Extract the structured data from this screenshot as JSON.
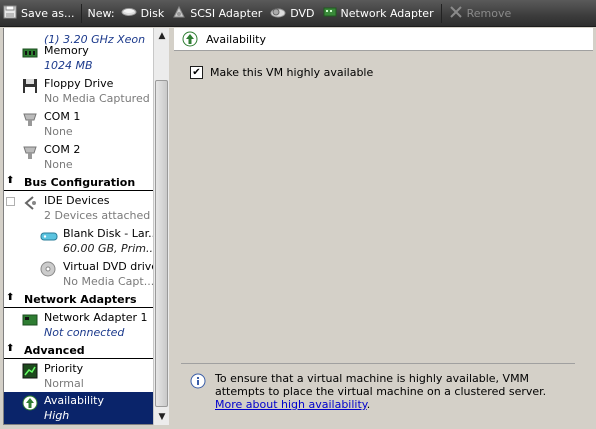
{
  "toolbar": {
    "save_as": "Save as...",
    "new_label": "New:",
    "disk": "Disk",
    "scsi": "SCSI Adapter",
    "dvd": "DVD",
    "network": "Network Adapter",
    "remove": "Remove"
  },
  "hardware": {
    "cpu_partial": "(1) 3.20 GHz Xeon",
    "memory": {
      "label": "Memory",
      "value": "1024 MB"
    },
    "floppy": {
      "label": "Floppy Drive",
      "value": "No Media Captured"
    },
    "com1": {
      "label": "COM 1",
      "value": "None"
    },
    "com2": {
      "label": "COM 2",
      "value": "None"
    }
  },
  "sections": {
    "bus": "Bus Configuration",
    "network": "Network Adapters",
    "advanced": "Advanced"
  },
  "bus": {
    "ide": {
      "label": "IDE Devices",
      "value": "2 Devices attached"
    },
    "disk": {
      "label": "Blank Disk - Lar...",
      "value": "60.00 GB, Prim..."
    },
    "dvd": {
      "label": "Virtual DVD drive",
      "value": "No Media Capt..."
    }
  },
  "net": {
    "adapter1": {
      "label": "Network Adapter 1",
      "value": "Not connected"
    }
  },
  "advanced": {
    "priority": {
      "label": "Priority",
      "value": "Normal"
    },
    "availability": {
      "label": "Availability",
      "value": "High"
    }
  },
  "details": {
    "title": "Availability",
    "checkbox_label": "Make this VM highly available",
    "checkbox_checked": true,
    "info_text": "To ensure that a virtual machine is highly available, VMM attempts to place the virtual machine on a clustered server.",
    "info_link": "More about high availability",
    "info_end": "."
  }
}
